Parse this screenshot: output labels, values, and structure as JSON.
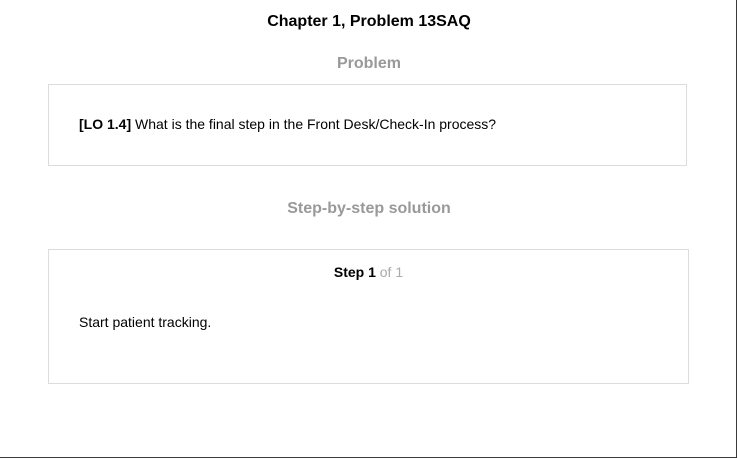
{
  "page": {
    "title": "Chapter 1, Problem 13SAQ"
  },
  "problem": {
    "heading": "Problem",
    "lo_tag": "[LO 1.4]",
    "question": "What is the final step in the Front Desk/Check-In process?"
  },
  "solution": {
    "heading": "Step-by-step solution",
    "step_label": "Step 1",
    "step_of": "of 1",
    "step_text": "Start patient tracking."
  }
}
